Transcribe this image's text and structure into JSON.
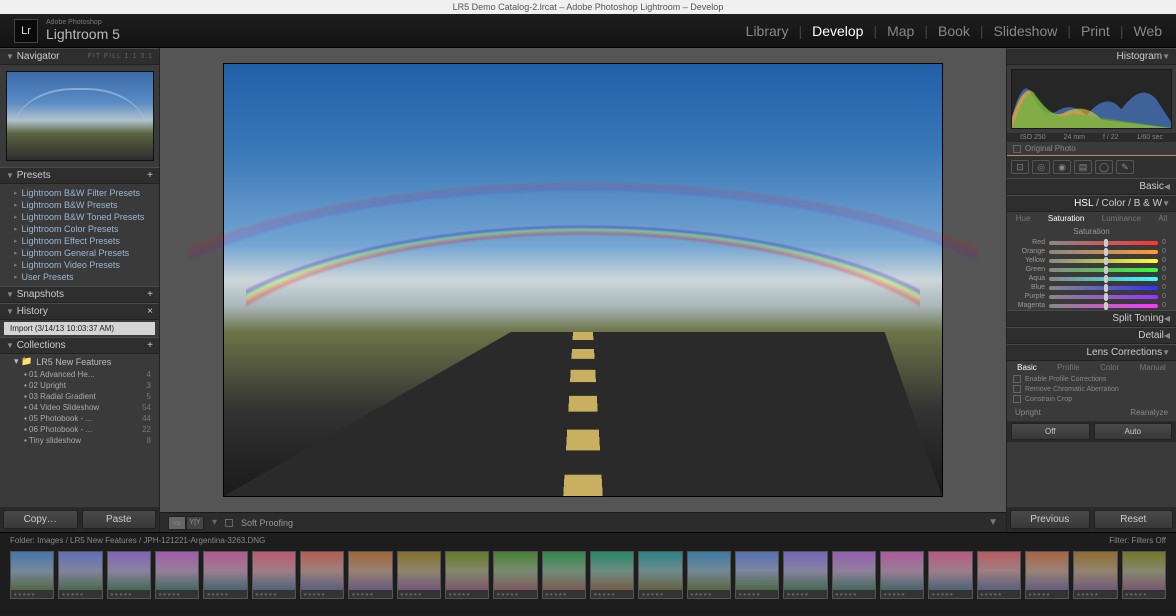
{
  "titlebar": "LR5 Demo Catalog-2.lrcat – Adobe Photoshop Lightroom – Develop",
  "brand": {
    "logo": "Lr",
    "name": "Lightroom 5",
    "tagline": "Adobe Photoshop"
  },
  "nav": {
    "items": [
      "Library",
      "Develop",
      "Map",
      "Book",
      "Slideshow",
      "Print",
      "Web"
    ],
    "active": "Develop"
  },
  "left": {
    "navigator": {
      "label": "Navigator",
      "opts": "FIT  FILL  1:1  3:1"
    },
    "presets": {
      "label": "Presets",
      "items": [
        "Lightroom B&W Filter Presets",
        "Lightroom B&W Presets",
        "Lightroom B&W Toned Presets",
        "Lightroom Color Presets",
        "Lightroom Effect Presets",
        "Lightroom General Presets",
        "Lightroom Video Presets",
        "User Presets"
      ]
    },
    "snapshots": {
      "label": "Snapshots"
    },
    "history": {
      "label": "History",
      "items": [
        "Import (3/14/13 10:03:37 AM)"
      ]
    },
    "collections": {
      "label": "Collections",
      "root": "LR5 New Features",
      "items": [
        {
          "name": "01 Advanced He...",
          "count": "4"
        },
        {
          "name": "02 Upright",
          "count": "3"
        },
        {
          "name": "03 Radial Gradient",
          "count": "5"
        },
        {
          "name": "04 Video Slideshow",
          "count": "54"
        },
        {
          "name": "05 Photobook - ...",
          "count": "44"
        },
        {
          "name": "06 Photobook - ...",
          "count": "22"
        },
        {
          "name": "Tiny slideshow",
          "count": "8"
        }
      ]
    },
    "buttons": {
      "copy": "Copy…",
      "paste": "Paste"
    }
  },
  "center": {
    "toolbar": {
      "soft_proof": "Soft Proofing"
    }
  },
  "right": {
    "histogram": {
      "label": "Histogram",
      "info": [
        "ISO 250",
        "24 mm",
        "f / 22",
        "1/60 sec"
      ]
    },
    "original": "Original Photo",
    "basic": {
      "label": "Basic"
    },
    "hsl": {
      "label_segments": [
        "HSL",
        "Color",
        "B & W"
      ],
      "tabs": [
        "Hue",
        "Saturation",
        "Luminance",
        "All"
      ],
      "active_tab": "Saturation",
      "section": "Saturation",
      "sliders": [
        {
          "name": "Red",
          "grad": "linear-gradient(to right,#888,#f33)",
          "val": "0"
        },
        {
          "name": "Orange",
          "grad": "linear-gradient(to right,#888,#f93)",
          "val": "0"
        },
        {
          "name": "Yellow",
          "grad": "linear-gradient(to right,#888,#ff3)",
          "val": "0"
        },
        {
          "name": "Green",
          "grad": "linear-gradient(to right,#888,#3f3)",
          "val": "0"
        },
        {
          "name": "Aqua",
          "grad": "linear-gradient(to right,#888,#3ff)",
          "val": "0"
        },
        {
          "name": "Blue",
          "grad": "linear-gradient(to right,#888,#33f)",
          "val": "0"
        },
        {
          "name": "Purple",
          "grad": "linear-gradient(to right,#888,#93f)",
          "val": "0"
        },
        {
          "name": "Magenta",
          "grad": "linear-gradient(to right,#888,#f3f)",
          "val": "0"
        }
      ]
    },
    "split_toning": "Split Toning",
    "detail": "Detail",
    "lens": {
      "label": "Lens Corrections",
      "tabs": [
        "Basic",
        "Profile",
        "Color",
        "Manual"
      ],
      "options": [
        "Enable Profile Corrections",
        "Remove Chromatic Aberration",
        "Constrain Crop"
      ],
      "upright": "Upright",
      "reanalyze": "Reanalyze",
      "off": "Off",
      "auto": "Auto"
    },
    "buttons": {
      "previous": "Previous",
      "reset": "Reset"
    }
  },
  "filmstrip": {
    "path": "Folder: Images / LR5 New Features / JPH-121221-Argentina-3263.DNG",
    "filter_label": "Filter:",
    "filter_value": "Filters Off",
    "count": 24
  }
}
